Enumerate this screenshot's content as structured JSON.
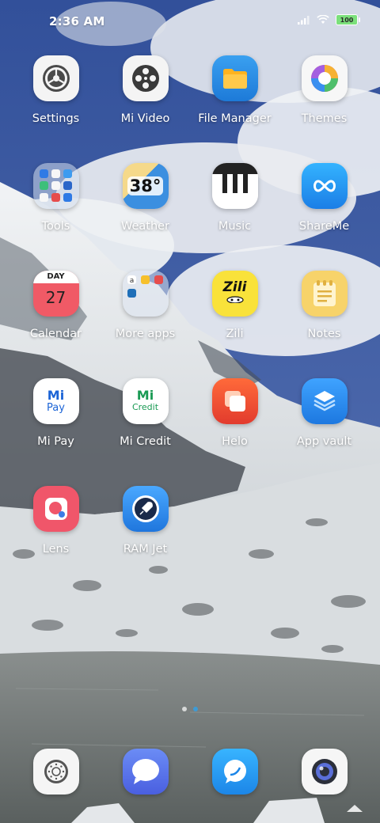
{
  "status_bar": {
    "time": "2:36 AM",
    "battery": "100"
  },
  "apps": [
    {
      "label": "Settings",
      "icon": "settings-icon"
    },
    {
      "label": "Mi Video",
      "icon": "film-reel-icon"
    },
    {
      "label": "File Manager",
      "icon": "folder-icon"
    },
    {
      "label": "Themes",
      "icon": "themes-icon"
    },
    {
      "label": "Tools",
      "icon": "tools-folder-icon"
    },
    {
      "label": "Weather",
      "icon": "weather-icon",
      "temp": "38°"
    },
    {
      "label": "Music",
      "icon": "piano-keys-icon"
    },
    {
      "label": "ShareMe",
      "icon": "share-infinity-icon"
    },
    {
      "label": "Calendar",
      "icon": "calendar-icon",
      "day": "DAY",
      "date": "27"
    },
    {
      "label": "More apps",
      "icon": "more-apps-folder-icon"
    },
    {
      "label": "Zili",
      "icon": "zili-icon",
      "text": "Zili"
    },
    {
      "label": "Notes",
      "icon": "notes-icon"
    },
    {
      "label": "Mi Pay",
      "icon": "mi-pay-icon",
      "text_top": "Mi",
      "text_bottom": "Pay"
    },
    {
      "label": "Mi Credit",
      "icon": "mi-credit-icon",
      "text_top": "Mi",
      "text_bottom": "Credit"
    },
    {
      "label": "Helo",
      "icon": "helo-icon"
    },
    {
      "label": "App vault",
      "icon": "app-vault-icon"
    },
    {
      "label": "Lens",
      "icon": "lens-icon"
    },
    {
      "label": "RAM Jet",
      "icon": "rocket-icon"
    }
  ],
  "dock": [
    {
      "icon": "camera-shutter-icon"
    },
    {
      "icon": "messages-icon"
    },
    {
      "icon": "chat-bubble-icon"
    },
    {
      "icon": "camera-icon"
    }
  ],
  "colors": {
    "sky": "#3c5a9c",
    "snow": "#e8ecf0",
    "lake": "#6e7473",
    "page_indicator_active": "#3d9bd6"
  }
}
